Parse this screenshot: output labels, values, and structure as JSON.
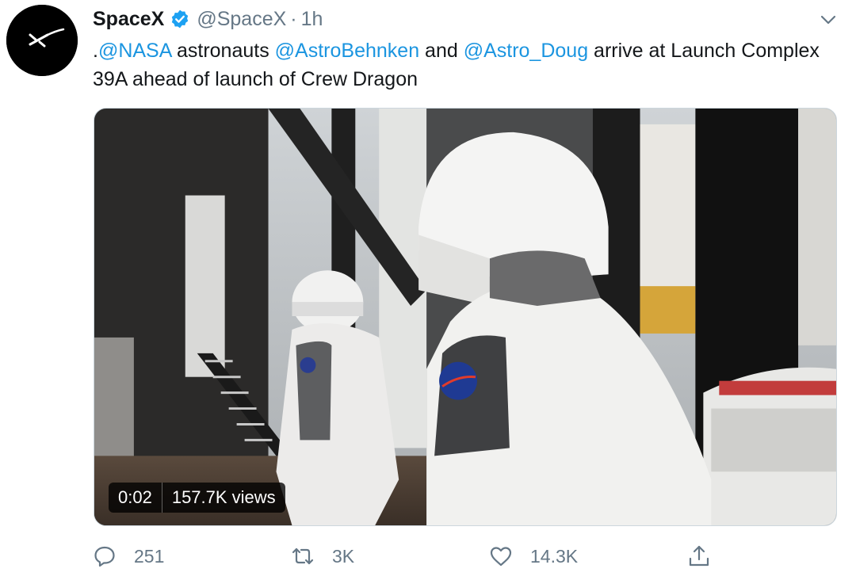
{
  "tweet": {
    "author_name": "SpaceX",
    "handle": "@SpaceX",
    "separator": "·",
    "time": "1h",
    "text": {
      "prefix": ".",
      "mention1": "@NASA",
      "part1": " astronauts ",
      "mention2": "@AstroBehnken",
      "part2": " and ",
      "mention3": "@Astro_Doug",
      "part3": " arrive at Launch Complex 39A ahead of launch of Crew Dragon"
    },
    "video": {
      "duration": "0:02",
      "views": "157.7K views"
    },
    "actions": {
      "replies": "251",
      "retweets": "3K",
      "likes": "14.3K"
    }
  },
  "colors": {
    "link": "#1b95e0",
    "secondary_text": "#657786",
    "primary_text": "#14171a",
    "verified": "#1da1f2"
  },
  "icons": [
    "spacex-logo-icon",
    "verified-badge-icon",
    "chevron-down-icon",
    "reply-icon",
    "retweet-icon",
    "like-icon",
    "share-icon"
  ]
}
